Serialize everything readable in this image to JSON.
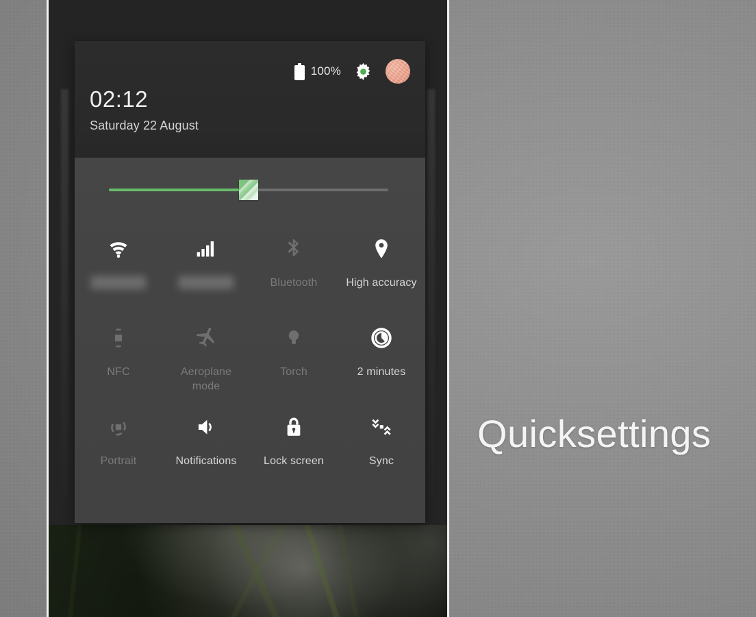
{
  "caption": "Quicksettings",
  "status": {
    "battery_icon": "battery-full-icon",
    "battery_level": "100%",
    "settings_icon": "gear-icon",
    "avatar_icon": "user-avatar"
  },
  "clock": {
    "time": "02:12",
    "date": "Saturday 22 August"
  },
  "brightness": {
    "label": "brightness-slider",
    "value": 50,
    "fill_color": "#67bb6a",
    "track_color": "#6e6e6e"
  },
  "tiles": [
    {
      "icon": "wifi-icon",
      "label": "",
      "state": "on",
      "blurred": true
    },
    {
      "icon": "mobile-signal-icon",
      "label": "",
      "state": "on",
      "blurred": true
    },
    {
      "icon": "bluetooth-icon",
      "label": "Bluetooth",
      "state": "off",
      "blurred": false
    },
    {
      "icon": "location-pin-icon",
      "label": "High accuracy",
      "state": "on",
      "blurred": false
    },
    {
      "icon": "nfc-icon",
      "label": "NFC",
      "state": "off",
      "blurred": false
    },
    {
      "icon": "aeroplane-icon",
      "label": "Aeroplane mode",
      "state": "off",
      "blurred": false
    },
    {
      "icon": "torch-icon",
      "label": "Torch",
      "state": "off",
      "blurred": false
    },
    {
      "icon": "sleep-timer-icon",
      "label": "2 minutes",
      "state": "on",
      "blurred": false
    },
    {
      "icon": "auto-rotate-icon",
      "label": "Portrait",
      "state": "off",
      "blurred": false
    },
    {
      "icon": "volume-icon",
      "label": "Notifications",
      "state": "on",
      "blurred": false
    },
    {
      "icon": "lock-icon",
      "label": "Lock screen",
      "state": "on",
      "blurred": false
    },
    {
      "icon": "sync-icon",
      "label": "Sync",
      "state": "on",
      "blurred": false
    }
  ]
}
